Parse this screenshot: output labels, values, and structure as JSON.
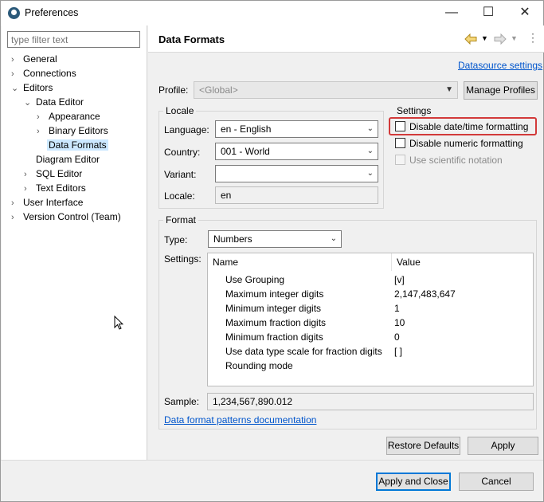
{
  "window": {
    "title": "Preferences",
    "minimize": "—",
    "maximize": "☐",
    "close": "✕"
  },
  "sidebar": {
    "filter_placeholder": "type filter text",
    "items": [
      {
        "label": "General",
        "chev": "›"
      },
      {
        "label": "Connections",
        "chev": "›"
      },
      {
        "label": "Editors",
        "chev": "⌄"
      },
      {
        "label": "Data Editor",
        "chev": "⌄"
      },
      {
        "label": "Appearance",
        "chev": "›"
      },
      {
        "label": "Binary Editors",
        "chev": "›"
      },
      {
        "label": "Data Formats",
        "chev": ""
      },
      {
        "label": "Diagram Editor",
        "chev": ""
      },
      {
        "label": "SQL Editor",
        "chev": "›"
      },
      {
        "label": "Text Editors",
        "chev": "›"
      },
      {
        "label": "User Interface",
        "chev": "›"
      },
      {
        "label": "Version Control (Team)",
        "chev": "›"
      }
    ]
  },
  "page": {
    "title": "Data Formats",
    "datasource_link": "Datasource settings",
    "profile_label": "Profile:",
    "profile_value": "<Global>",
    "manage_profiles": "Manage Profiles"
  },
  "locale": {
    "group_title": "Locale",
    "language_label": "Language:",
    "language_value": "en - English",
    "country_label": "Country:",
    "country_value": "001 - World",
    "variant_label": "Variant:",
    "variant_value": "",
    "locale_label": "Locale:",
    "locale_value": "en"
  },
  "settings": {
    "group_title": "Settings",
    "disable_datetime": "Disable date/time formatting",
    "disable_numeric": "Disable numeric formatting",
    "scientific": "Use scientific notation"
  },
  "format": {
    "group_title": "Format",
    "type_label": "Type:",
    "type_value": "Numbers",
    "settings_label": "Settings:",
    "col_name": "Name",
    "col_value": "Value",
    "rows": [
      {
        "name": "Use Grouping",
        "value": "[v]"
      },
      {
        "name": "Maximum integer digits",
        "value": "2,147,483,647"
      },
      {
        "name": "Minimum integer digits",
        "value": "1"
      },
      {
        "name": "Maximum fraction digits",
        "value": "10"
      },
      {
        "name": "Minimum fraction digits",
        "value": "0"
      },
      {
        "name": "Use data type scale for fraction digits",
        "value": "[ ]"
      },
      {
        "name": "Rounding mode",
        "value": ""
      }
    ],
    "sample_label": "Sample:",
    "sample_value": "1,234,567,890.012",
    "doc_link": "Data format patterns documentation"
  },
  "buttons": {
    "restore_defaults": "Restore Defaults",
    "apply": "Apply",
    "apply_close": "Apply and Close",
    "cancel": "Cancel"
  }
}
